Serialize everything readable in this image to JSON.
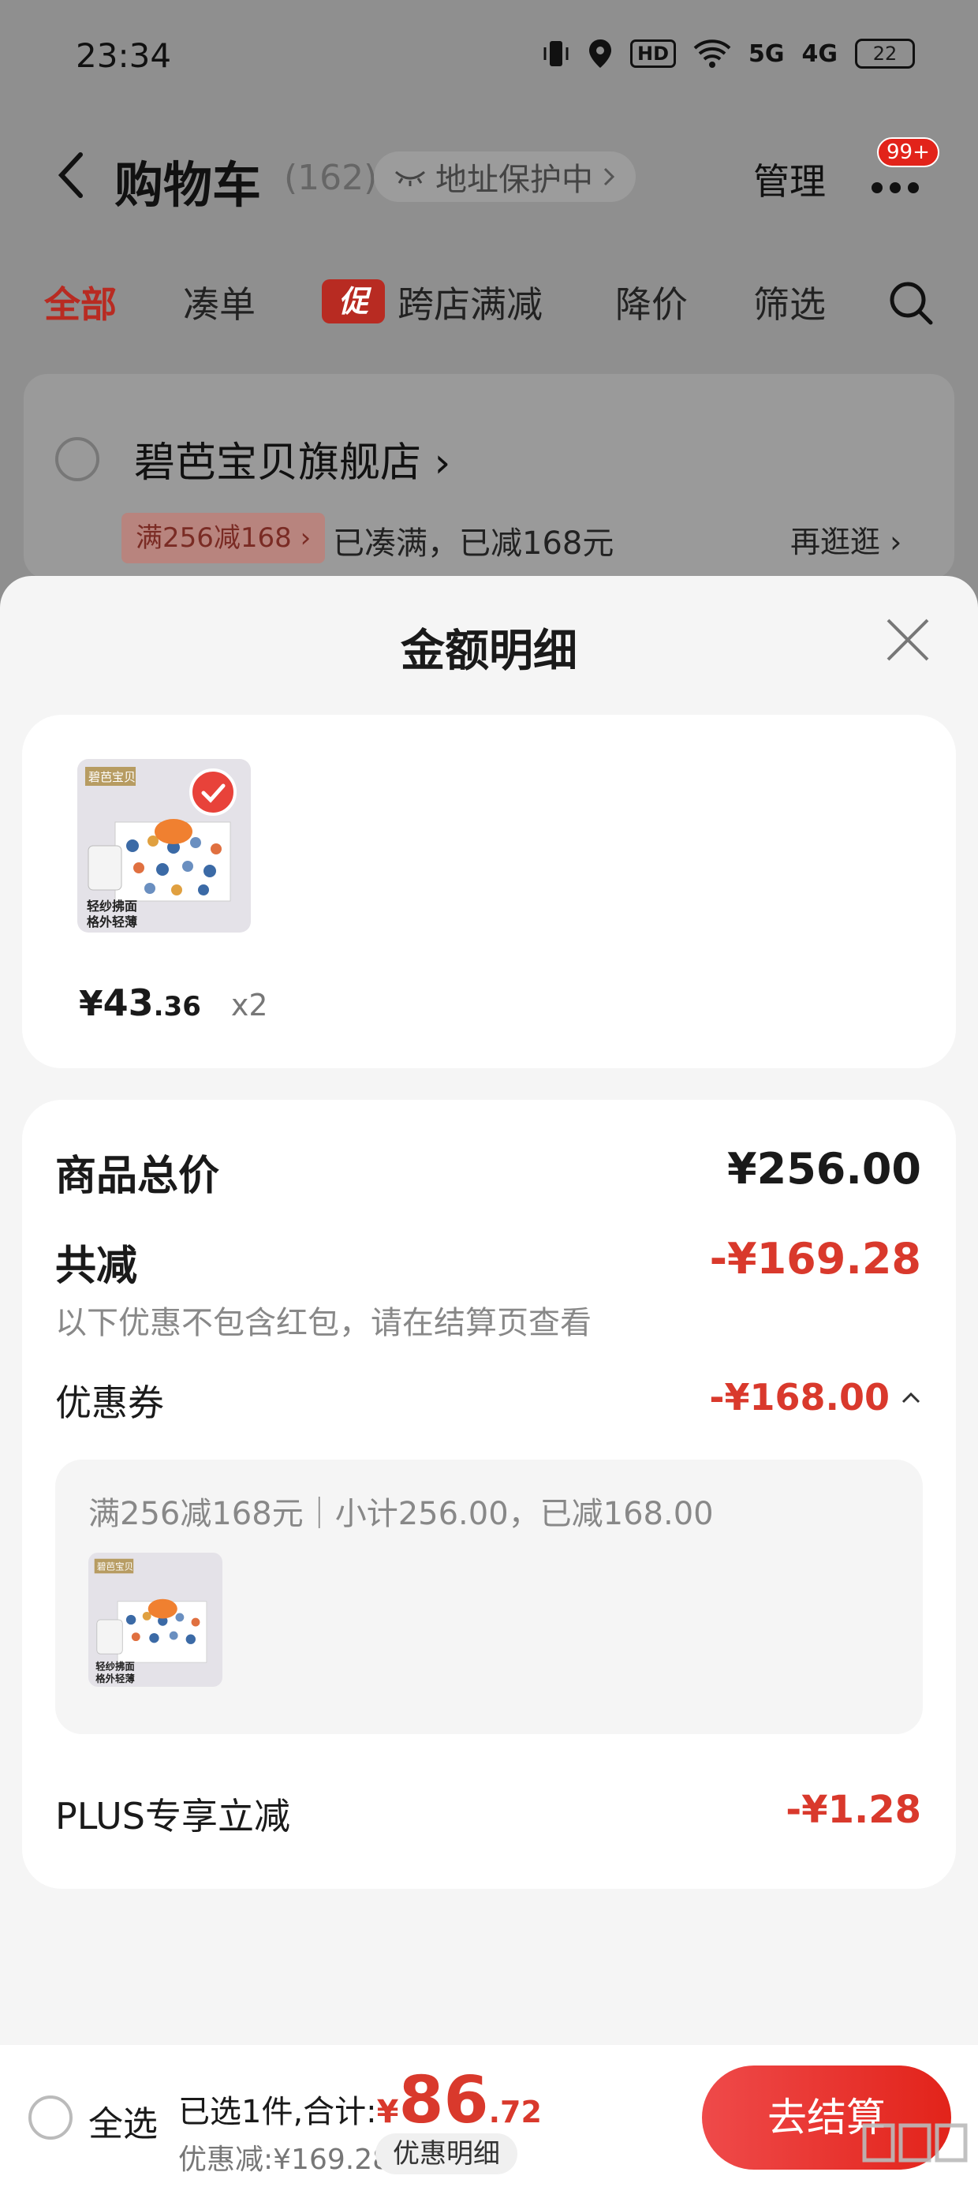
{
  "status_bar": {
    "time": "23:34",
    "icons": [
      "vibrate-icon",
      "location-icon",
      "hd-icon",
      "wifi-icon",
      "5g-signal-icon",
      "4g-signal-icon"
    ],
    "hd_label": "HD",
    "net_5g": "5G",
    "net_4g": "4G",
    "battery": "22"
  },
  "header": {
    "title": "购物车",
    "count": "(162)",
    "address_protect": "地址保护中",
    "manage": "管理",
    "message_badge": "99+"
  },
  "tabs": [
    {
      "label": "全部",
      "active": true
    },
    {
      "label": "凑单",
      "active": false
    },
    {
      "label": "跨店满减",
      "active": false,
      "tag": "促"
    },
    {
      "label": "降价",
      "active": false
    },
    {
      "label": "筛选",
      "active": false
    }
  ],
  "store": {
    "name": "碧芭宝贝旗舰店",
    "coupon_chip": "满256减168",
    "coupon_status": "已凑满，已减168元",
    "browse_more": "再逛逛"
  },
  "sheet": {
    "title": "金额明细",
    "item": {
      "brand_tag": "碧芭宝贝",
      "product_caption_1": "轻纱拂面",
      "product_caption_2": "格外轻薄",
      "price_symbol": "¥",
      "price_int": "43",
      "price_dec": ".36",
      "qty": "x2"
    },
    "summary": {
      "goods_total_label": "商品总价",
      "goods_total_value": "¥256.00",
      "total_discount_label": "共减",
      "total_discount_value": "-¥169.28",
      "note": "以下优惠不包含红包，请在结算页查看",
      "coupon_label": "优惠券",
      "coupon_value": "-¥168.00",
      "coupon_detail": "满256减168元｜小计256.00，已减168.00",
      "plus_label": "PLUS专享立减",
      "plus_value": "-¥1.28"
    }
  },
  "bottom_bar": {
    "select_all": "全选",
    "total_prefix": "已选1件,合计:",
    "total_symbol": "¥",
    "total_int": "86",
    "total_dec": ".72",
    "discount_text": "优惠减:¥169.28",
    "detail_button": "优惠明细",
    "checkout": "去结算"
  },
  "colors": {
    "accent_red": "#d9392c",
    "brand_red": "#e2231a",
    "overlay": "#8f8f8f"
  }
}
